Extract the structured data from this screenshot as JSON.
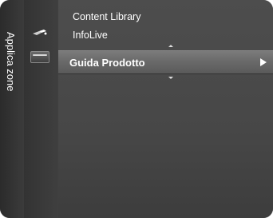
{
  "sidebar": {
    "vertical_title": "Applica zone"
  },
  "menu": {
    "items": [
      {
        "label": "Content Library"
      },
      {
        "label": "InfoLive"
      },
      {
        "label": "Guida Prodotto",
        "selected": true
      }
    ]
  },
  "icons": {
    "content_library_icon": "satellite-icon",
    "infolive_icon": "tv-screen-icon",
    "selected_arrow": "right-triangle-icon"
  },
  "colors": {
    "background": "#4a4a4a",
    "selected_bar": "#6a6a6a",
    "text": "#ffffff"
  }
}
